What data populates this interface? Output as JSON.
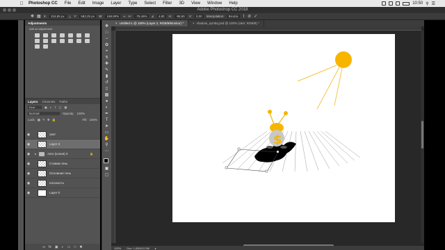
{
  "menubar": {
    "app_name": "Photoshop CC",
    "items": [
      "File",
      "Edit",
      "Image",
      "Layer",
      "Type",
      "Select",
      "Filter",
      "3D",
      "View",
      "Window",
      "Help"
    ],
    "clock": "10:50"
  },
  "window": {
    "title": "Adobe Photoshop CC 2018"
  },
  "options": {
    "x_label": "X:",
    "x_value": "318,85 px",
    "y_label": "Y:",
    "y_value": "582,25 px",
    "w_label": "W:",
    "w_value": "168,90%",
    "h_label": "H:",
    "h_value": "-78,46%",
    "angle_value": "4,80",
    "h_skew_label": "H:",
    "h_skew_value": "-98,80",
    "v_skew_label": "V:",
    "v_skew_value": "0,00",
    "interpolation_label": "Interpolation:",
    "interpolation_value": "Bicubic"
  },
  "adjustments": {
    "tab": "Adjustments",
    "subtitle": "Add an adjustment"
  },
  "layers_panel": {
    "tabs": [
      "Layers",
      "Channels",
      "Paths"
    ],
    "kind": "Kind",
    "blend_mode": "Normal",
    "opacity_label": "Opacity:",
    "opacity_value": "100%",
    "lock_label": "Lock:",
    "fill_label": "Fill:",
    "fill_value": "100%",
    "layers": [
      {
        "name": "свет",
        "thumb": "checker"
      },
      {
        "name": "Layer 3",
        "thumb": "checker",
        "selected": true
      },
      {
        "name": "лого (копия) 3",
        "thumb": "folder",
        "locked": true
      },
      {
        "name": "Ставим тень",
        "thumb": "checker"
      },
      {
        "name": "Основная тень",
        "thumb": "checker"
      },
      {
        "name": "плоскость",
        "thumb": "checker"
      },
      {
        "name": "Layer 0",
        "thumb": "white"
      }
    ]
  },
  "doc_tabs": [
    {
      "label": "Untitled-1 @ 100% (Layer 2, RGB/8/Monitor) *",
      "active": true
    },
    {
      "label": "shadow_symbq.psd @ 100% (свет, RGB/8) *",
      "active": false
    }
  ],
  "status": {
    "zoom": "100%",
    "doc_info": "Doc: 1,83M/12,5M"
  },
  "colors": {
    "sun": "#f7b500",
    "sun_rays": "#f5c542",
    "ui_bg": "#535353",
    "doc_bg": "#282828"
  }
}
